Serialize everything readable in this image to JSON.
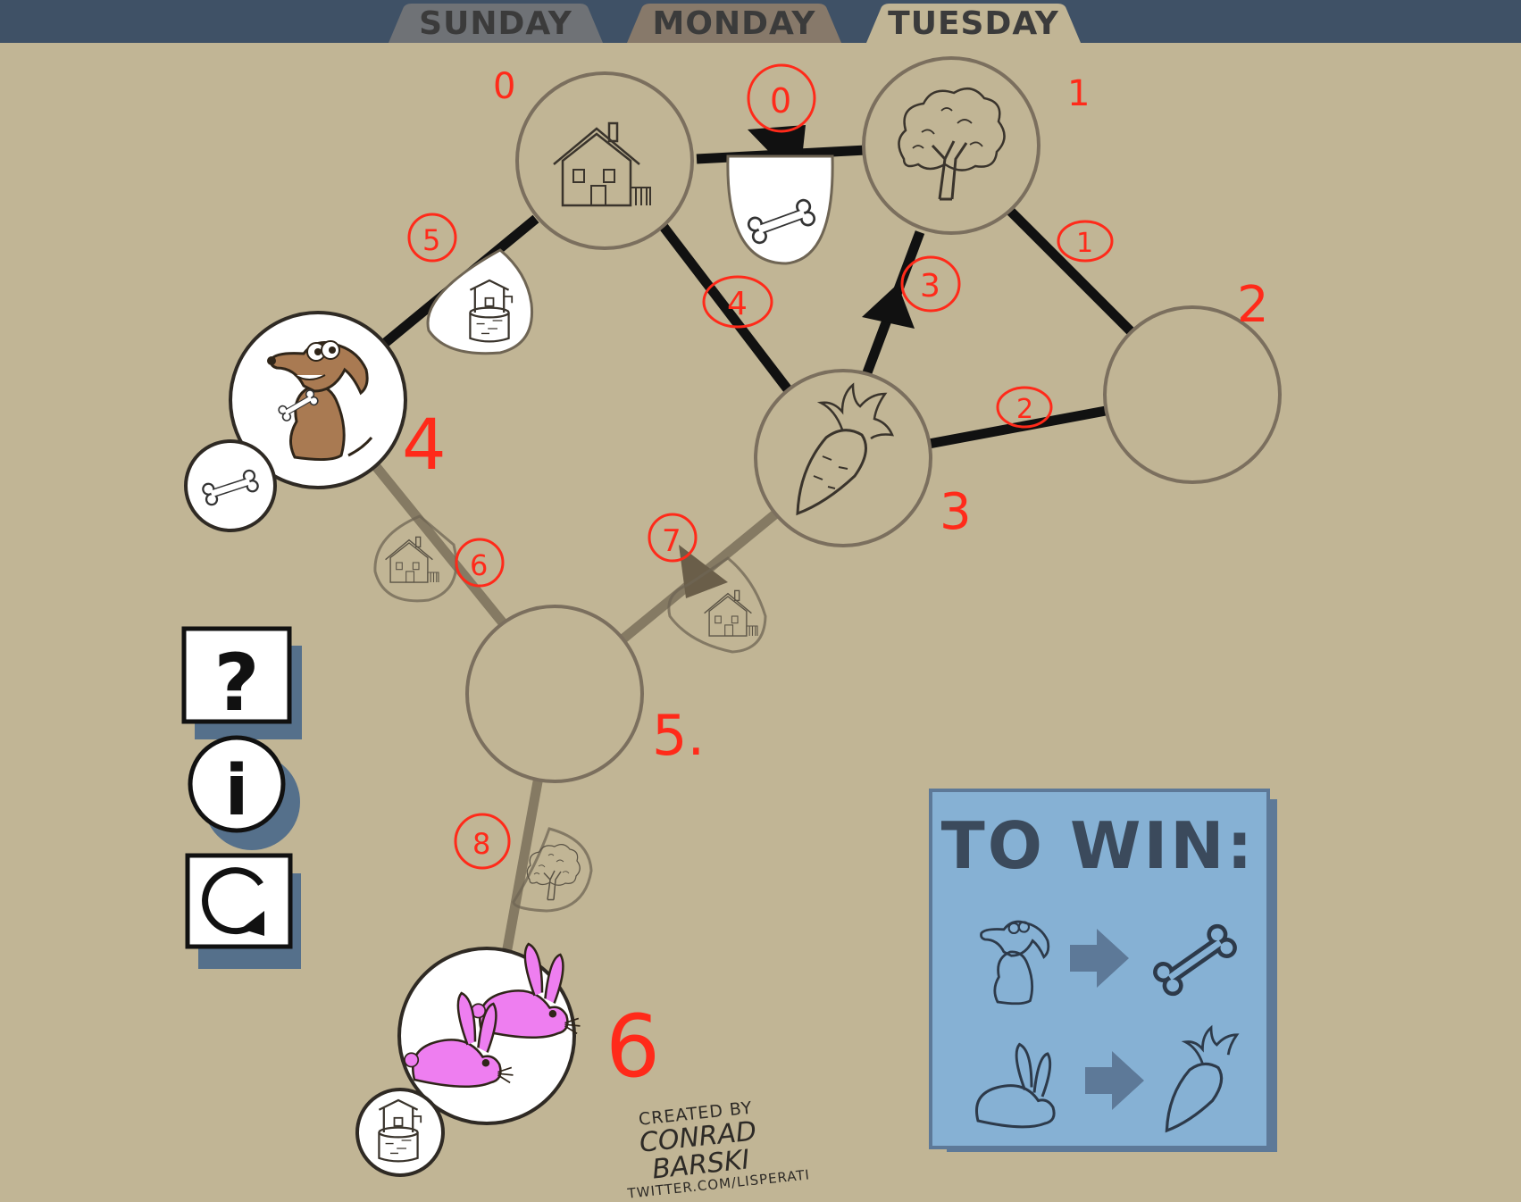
{
  "tabs": [
    {
      "label": "SUNDAY",
      "fill": "#6f7276",
      "active": false
    },
    {
      "label": "MONDAY",
      "fill": "#87796a",
      "active": false
    },
    {
      "label": "TUESDAY",
      "fill": "#c1b595",
      "active": true
    }
  ],
  "colors": {
    "board_background": "#c1b595",
    "top_bar": "#3f5166",
    "node_outline": "#7b6f5e",
    "active_edge": "#111111",
    "inactive_edge": "#857a63",
    "annotation": "#ff2a1a",
    "win_panel": "#86b1d4",
    "bunny": "#ee7ef0",
    "dog": "#a97a52"
  },
  "nodes": [
    {
      "id": "0",
      "contents": "house-icon",
      "annotation": "0"
    },
    {
      "id": "1",
      "contents": "tree-icon",
      "annotation": "1"
    },
    {
      "id": "2",
      "contents": "empty",
      "annotation": "2"
    },
    {
      "id": "3",
      "contents": "carrot-icon",
      "annotation": "3"
    },
    {
      "id": "4",
      "contents": "dog-icon",
      "annotation": "4",
      "carried": "bone-icon"
    },
    {
      "id": "5",
      "contents": "empty",
      "annotation": "5."
    },
    {
      "id": "6",
      "contents": "bunnies-icon",
      "annotation": "6",
      "carried": "well-icon"
    }
  ],
  "edges": [
    {
      "from": "1",
      "to": "0",
      "label": "0",
      "key": "bone-icon",
      "style": "active",
      "arrow": true
    },
    {
      "from": "1",
      "to": "2",
      "label": "1",
      "style": "active"
    },
    {
      "from": "2",
      "to": "3",
      "label": "2",
      "style": "active"
    },
    {
      "from": "3",
      "to": "1",
      "label": "3",
      "style": "active",
      "arrow": true
    },
    {
      "from": "0",
      "to": "3",
      "label": "4",
      "style": "active"
    },
    {
      "from": "0",
      "to": "4",
      "label": "5",
      "key": "well-icon",
      "style": "active"
    },
    {
      "from": "4",
      "to": "5",
      "label": "6",
      "key": "house-icon",
      "style": "inactive"
    },
    {
      "from": "5",
      "to": "3",
      "label": "7",
      "key": "house-icon",
      "style": "inactive",
      "arrow": true
    },
    {
      "from": "5",
      "to": "6",
      "label": "8",
      "key": "tree-icon",
      "style": "inactive"
    }
  ],
  "controls": {
    "help_glyph": "?",
    "info_glyph": "i",
    "restart_icon": "restart-icon"
  },
  "credit": {
    "line1": "CREATED BY",
    "line2": "CONRAD BARSKI",
    "line3": "TWITTER.COM/LISPERATI"
  },
  "win": {
    "title": "TO WIN:",
    "goals": [
      {
        "who": "dog-icon",
        "target": "bone-icon"
      },
      {
        "who": "bunny-icon",
        "target": "carrot-icon"
      }
    ]
  }
}
